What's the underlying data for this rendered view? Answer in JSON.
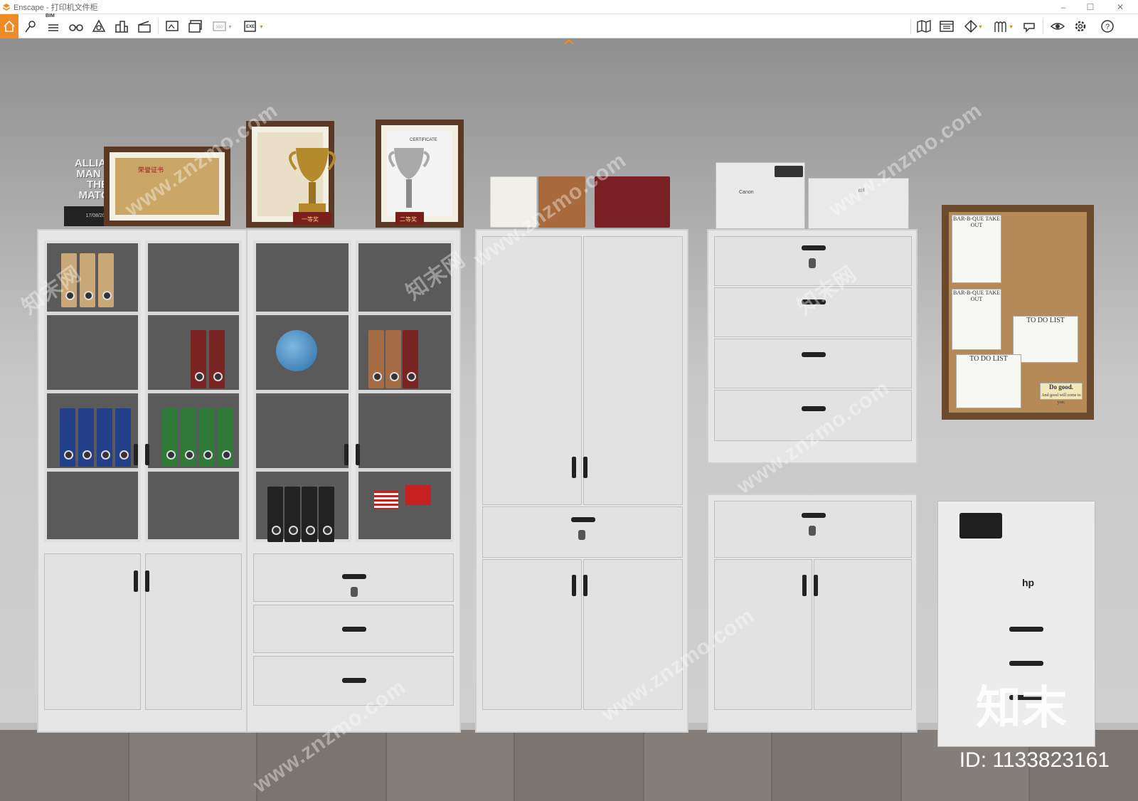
{
  "window": {
    "app_name": "Enscape",
    "title": "Enscape - 打印机文件柜",
    "controls": {
      "minimize": "–",
      "maximize": "☐",
      "close": "✕"
    }
  },
  "toolbar": {
    "left_buttons": [
      {
        "id": "home",
        "icon": "home-icon",
        "active": true
      },
      {
        "id": "views",
        "icon": "location-pin-icon"
      },
      {
        "id": "bim",
        "icon": "bim-list-icon",
        "label": "BIM"
      },
      {
        "id": "binoculars",
        "icon": "binoculars-icon"
      },
      {
        "id": "asset",
        "icon": "asset-library-icon"
      },
      {
        "id": "buildings",
        "icon": "buildings-icon"
      },
      {
        "id": "clapper",
        "icon": "video-editor-icon"
      },
      {
        "id": "screenshot",
        "icon": "screenshot-icon"
      },
      {
        "id": "batch",
        "icon": "batch-render-icon"
      },
      {
        "id": "pano",
        "icon": "panorama-icon",
        "label": "360°"
      },
      {
        "id": "exe",
        "icon": "export-exe-icon",
        "label": "EXE"
      }
    ],
    "right_buttons": [
      {
        "id": "map",
        "icon": "map-icon"
      },
      {
        "id": "window",
        "icon": "window-icon"
      },
      {
        "id": "section",
        "icon": "section-icon"
      },
      {
        "id": "paint",
        "icon": "material-icon"
      },
      {
        "id": "cloud",
        "icon": "collaboration-icon"
      },
      {
        "id": "visual",
        "icon": "visual-settings-icon"
      },
      {
        "id": "settings",
        "icon": "gear-icon"
      },
      {
        "id": "help",
        "icon": "help-icon"
      }
    ],
    "accent_color": "#f08a24"
  },
  "scene": {
    "trophy_text": "ALLIANZ MAN OF THE MATCH",
    "trophy_date": "17/08/2019",
    "certificate_title": "荣誉证书",
    "certificate_label": "CERTIFICATE",
    "award_badge_1": "一等奖",
    "award_badge_2": "二等奖",
    "printer_brand_1": "Canon",
    "printer_brand_2": "mi",
    "printer_brand_3": "hp",
    "board_notes": [
      "BAR-B-QUE TAKE OUT",
      "BAR-B-QUE TAKE OUT",
      "TO DO LIST",
      "TO DO LIST",
      "Do good.",
      "And good will come to you."
    ]
  },
  "watermark": {
    "site": "www.znzmo.com",
    "brand_cn": "知末网",
    "logo": "知末",
    "id_text": "ID: 1133823161"
  }
}
